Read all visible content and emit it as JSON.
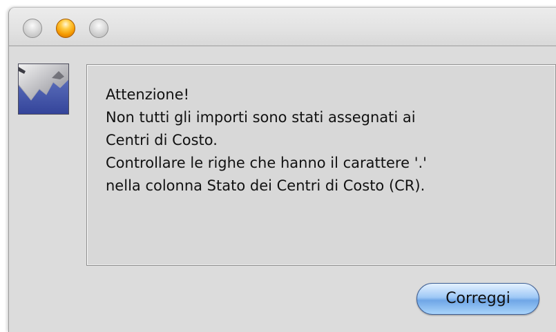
{
  "window": {
    "controls": [
      "close-icon",
      "minimize-icon",
      "zoom-icon"
    ]
  },
  "dialog": {
    "icon": "java-application-icon",
    "message_lines": [
      "Attenzione!",
      "Non tutti gli importi sono stati assegnati ai",
      "Centri di Costo.",
      "Controllare le righe che hanno il carattere '.'",
      "nella colonna Stato dei Centri di Costo (CR)."
    ],
    "button_label": "Correggi",
    "button_color": "#8dbdf2"
  }
}
